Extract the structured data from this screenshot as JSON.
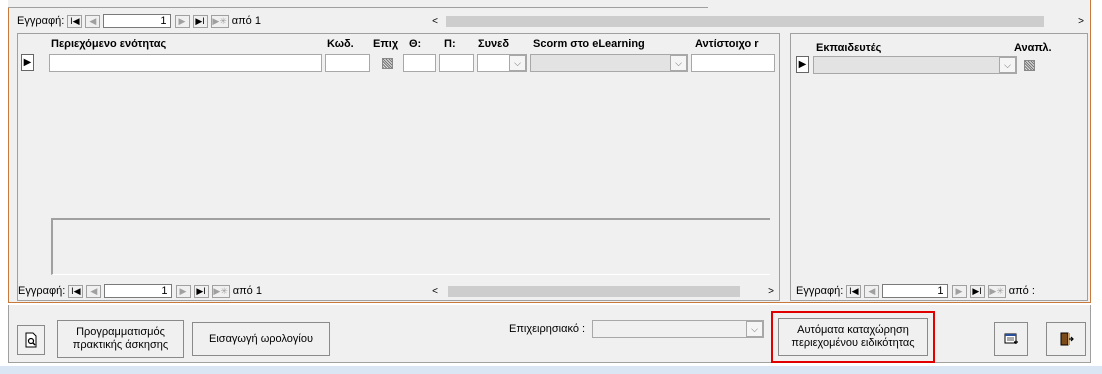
{
  "top_nav": {
    "label": "Εγγραφή:",
    "first": "I◀",
    "prev": "◀",
    "current": "1",
    "next": "▶",
    "last": "▶I",
    "new": "▶✳",
    "of_text": "από 1",
    "scroll_left": "<",
    "scroll_right": ">"
  },
  "content_table": {
    "headers": {
      "content": "Περιεχόμενο ενότητας",
      "code": "Κωδ.",
      "epix": "Επιχ",
      "theory": "Θ:",
      "practice": "Π:",
      "synedria": "Συνεδ",
      "scorm": "Scorm στο eLearning",
      "equivalent": "Αντίστοιχο r"
    },
    "row_selector": "▶",
    "nav": {
      "label": "Εγγραφή:",
      "first": "I◀",
      "prev": "◀",
      "current": "1",
      "next": "▶",
      "last": "▶I",
      "new": "▶✳",
      "of_text": "από 1",
      "scroll_left": "<",
      "scroll_right": ">"
    }
  },
  "trainers_table": {
    "headers": {
      "trainers": "Εκπαιδευτές",
      "replacement": "Αναπλ."
    },
    "row_selector": "▶",
    "nav": {
      "label": "Εγγραφή:",
      "first": "I◀",
      "prev": "◀",
      "current": "1",
      "next": "▶",
      "last": "▶I",
      "new": "▶✳",
      "of_text": "από :"
    }
  },
  "footer": {
    "preview_icon": "print-preview-icon",
    "schedule_practice_line1": "Προγραμματισμός",
    "schedule_practice_line2": "πρακτικής άσκησης",
    "import_timetable": "Εισαγωγή ωρολογίου",
    "business_label": "Επιχειρησιακό :",
    "business_value": "",
    "auto_register_line1": "Αυτόματα καταχώρηση",
    "auto_register_line2": "περιεχομένου ειδικότητας",
    "calendar_icon": "calendar-add-icon",
    "exit_icon": "exit-door-icon",
    "highlight_color": "#e00000"
  },
  "colors": {
    "bottom_bar": "#dbe6f4",
    "panel": "#f0f0f0",
    "border_orange": "#c87a3c"
  }
}
